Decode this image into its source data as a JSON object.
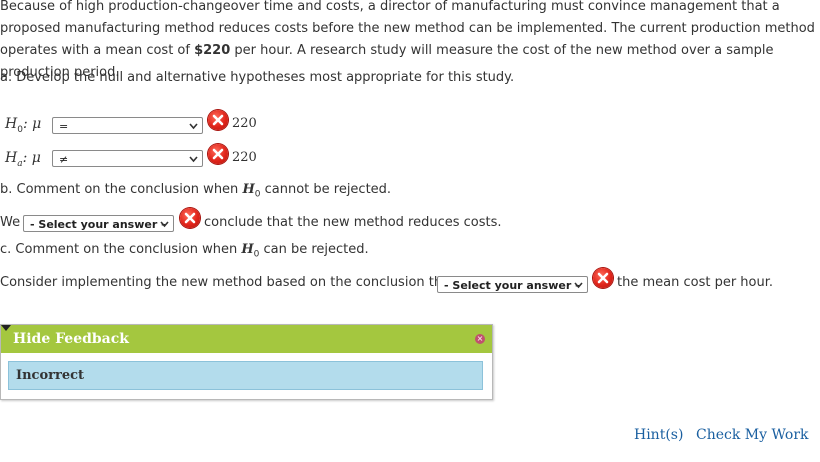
{
  "intro": {
    "part1": "Because of high production-changeover time and costs, a director of manufacturing must convince management that a proposed manufacturing method reduces costs before the new method can be implemented. The current production method operates with a mean cost of ",
    "cost": "$220",
    "part2": " per hour. A research study will measure the cost of the new method over a sample production period."
  },
  "part_a": {
    "prompt": "a. Develop the null and alternative hypotheses most appropriate for this study.",
    "h0_label": "H",
    "h0_sub": "0",
    "h0_colon": ": μ",
    "h0_select": "=",
    "h0_value": "220",
    "ha_label": "H",
    "ha_sub": "a",
    "ha_colon": ": μ",
    "ha_select": "≠",
    "ha_value": "220"
  },
  "part_b": {
    "prompt_pre": "b. Comment on the conclusion when ",
    "h": "H",
    "sub": "0",
    "prompt_post": " cannot be rejected.",
    "we": "We",
    "select": "- Select your answer -",
    "after": "conclude that the new method reduces costs."
  },
  "part_c": {
    "prompt_pre": "c. Comment on the conclusion when ",
    "h": "H",
    "sub": "0",
    "prompt_post": " can be rejected.",
    "before": "Consider implementing the new method based on the conclusion that it",
    "select": "- Select your answer -",
    "after": "the mean cost per hour."
  },
  "feedback": {
    "title": "Hide Feedback",
    "result": "Incorrect",
    "close": "×"
  },
  "footer": {
    "hints": "Hint(s)",
    "check": "Check My Work"
  },
  "colors": {
    "feedback_header": "#a4c73f",
    "feedback_body": "#b3dcec",
    "error_icon": "#e0241a",
    "link": "#1a5fa0"
  },
  "icons": {
    "incorrect": "x-circle-icon",
    "dropdown": "chevron-down-icon",
    "collapse": "triangle-down-icon",
    "close": "close-icon"
  }
}
